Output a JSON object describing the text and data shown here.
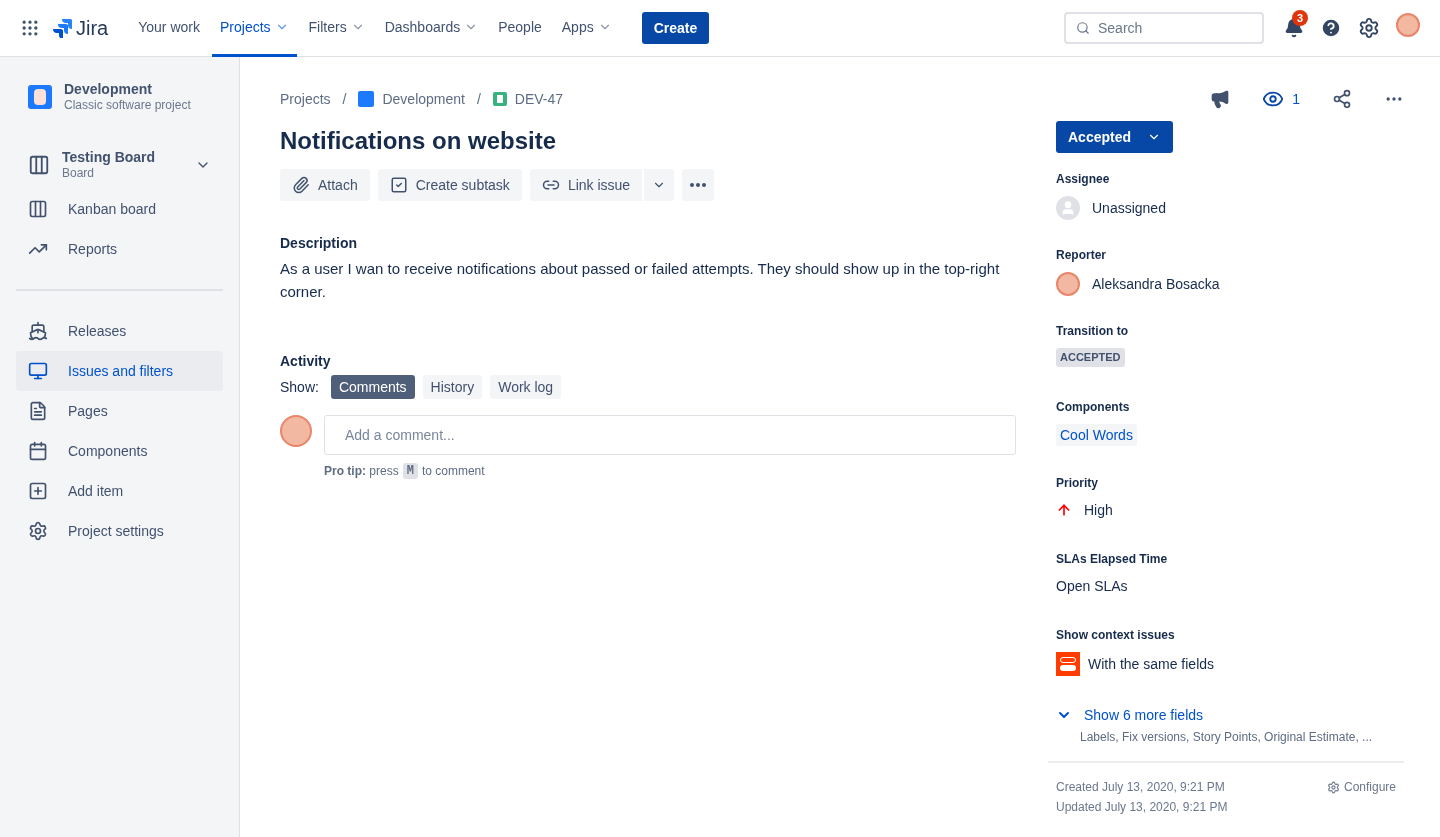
{
  "nav": {
    "logo": "Jira",
    "items": [
      {
        "label": "Your work",
        "selected": false,
        "dropdown": false
      },
      {
        "label": "Projects",
        "selected": true,
        "dropdown": true
      },
      {
        "label": "Filters",
        "selected": false,
        "dropdown": true
      },
      {
        "label": "Dashboards",
        "selected": false,
        "dropdown": true
      },
      {
        "label": "People",
        "selected": false,
        "dropdown": false
      },
      {
        "label": "Apps",
        "selected": false,
        "dropdown": true
      }
    ],
    "create": "Create",
    "search": {
      "placeholder": "Search"
    },
    "notification_count": "3"
  },
  "sidebar": {
    "project": {
      "name": "Development",
      "type": "Classic software project"
    },
    "board": {
      "name": "Testing Board",
      "type": "Board"
    },
    "groups": [
      [
        {
          "label": "Kanban board",
          "selected": false
        },
        {
          "label": "Reports",
          "selected": false
        }
      ],
      [
        {
          "label": "Releases",
          "selected": false
        },
        {
          "label": "Issues and filters",
          "selected": true
        },
        {
          "label": "Pages",
          "selected": false
        },
        {
          "label": "Components",
          "selected": false
        },
        {
          "label": "Add item",
          "selected": false
        },
        {
          "label": "Project settings",
          "selected": false
        }
      ]
    ]
  },
  "breadcrumbs": [
    "Projects",
    "Development",
    "DEV-47"
  ],
  "breadcrumb_separator": "/",
  "issue": {
    "title": "Notifications on website",
    "actions": [
      "Attach",
      "Create subtask",
      "Link issue"
    ],
    "description_label": "Description",
    "description": "As a user I wan to receive notifications about passed or failed attempts. They should show up in the top-right corner."
  },
  "activity": {
    "label": "Activity",
    "show_label": "Show:",
    "tabs": [
      {
        "label": "Comments",
        "selected": true
      },
      {
        "label": "History",
        "selected": false
      },
      {
        "label": "Work log",
        "selected": false
      }
    ],
    "comment_placeholder": "Add a comment...",
    "tip": "**Pro tip:** press",
    "tip_key": "M",
    "tip_end": "to comment"
  },
  "details": {
    "watchers": "1",
    "status": "Accepted",
    "fields": [
      {
        "label": "Assignee",
        "kind": "user-empty",
        "value": "Unassigned"
      },
      {
        "label": "Reporter",
        "kind": "user",
        "value": "Aleksandra Bosacka"
      },
      {
        "label": "Transition to",
        "kind": "lozenge",
        "value": "ACCEPTED"
      },
      {
        "label": "Components",
        "kind": "tag",
        "value": "Cool Words"
      },
      {
        "label": "Priority",
        "kind": "priority",
        "value": "High"
      },
      {
        "label": "SLAs Elapsed Time",
        "kind": "text",
        "value": "Open SLAs"
      },
      {
        "label": "Show context issues",
        "kind": "app",
        "value": "With the same fields"
      }
    ],
    "more": "Show 6 more fields",
    "more_list": "Labels, Fix versions, Story Points, Original Estimate, ...",
    "created": "Created July 13, 2020, 9:21 PM",
    "updated": "Updated July 13, 2020, 9:21 PM",
    "configure": "Configure"
  }
}
